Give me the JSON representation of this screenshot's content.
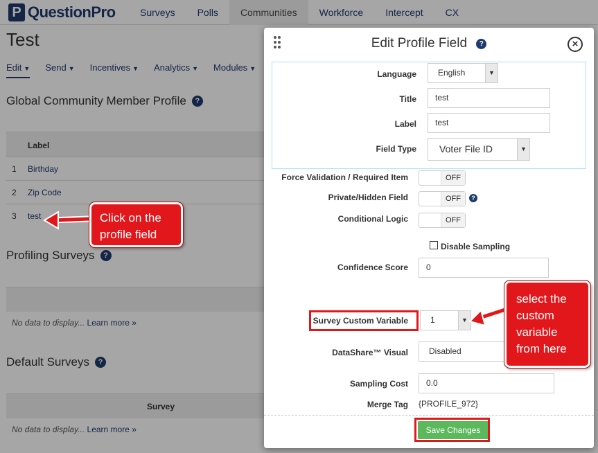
{
  "app": {
    "logo": "QuestionPro",
    "nav": [
      "Surveys",
      "Polls",
      "Communities",
      "Workforce",
      "Intercept",
      "CX"
    ],
    "active_nav": "Communities"
  },
  "page": {
    "title": "Test",
    "subnav": [
      "Edit",
      "Send",
      "Incentives",
      "Analytics",
      "Modules"
    ],
    "global_profile": {
      "title": "Global Community Member Profile",
      "column_label": "Label",
      "rows": [
        {
          "num": "1",
          "label": "Birthday"
        },
        {
          "num": "2",
          "label": "Zip Code"
        },
        {
          "num": "3",
          "label": "test"
        }
      ]
    },
    "profiling_surveys": {
      "title": "Profiling Surveys",
      "nodata": "No data to display...",
      "learn_more": "Learn more »"
    },
    "default_surveys": {
      "title": "Default Surveys",
      "column_survey": "Survey",
      "nodata": "No data to display...",
      "learn_more": "Learn more »"
    }
  },
  "modal": {
    "title": "Edit Profile Field",
    "close": "×",
    "fields": {
      "language_label": "Language",
      "language_value": "English",
      "title_label": "Title",
      "title_value": "test",
      "label_label": "Label",
      "label_value": "test",
      "field_type_label": "Field Type",
      "field_type_value": "Voter File ID",
      "force_validation_label": "Force Validation / Required Item",
      "force_validation_state": "OFF",
      "private_label": "Private/Hidden Field",
      "private_state": "OFF",
      "conditional_label": "Conditional Logic",
      "conditional_state": "OFF",
      "disable_sampling_label": "Disable Sampling",
      "confidence_label": "Confidence Score",
      "confidence_value": "0",
      "scv_label": "Survey Custom Variable",
      "scv_value": "1",
      "datashare_label": "DataShare™ Visual",
      "datashare_value": "Disabled",
      "sampling_cost_label": "Sampling Cost",
      "sampling_cost_value": "0.0",
      "merge_tag_label": "Merge Tag",
      "merge_tag_value": "{PROFILE_972}"
    },
    "save_label": "Save Changes"
  },
  "annotations": {
    "callout_left": "Click on the profile field",
    "callout_right": "select the custom variable from here",
    "color": "#e2171b"
  }
}
